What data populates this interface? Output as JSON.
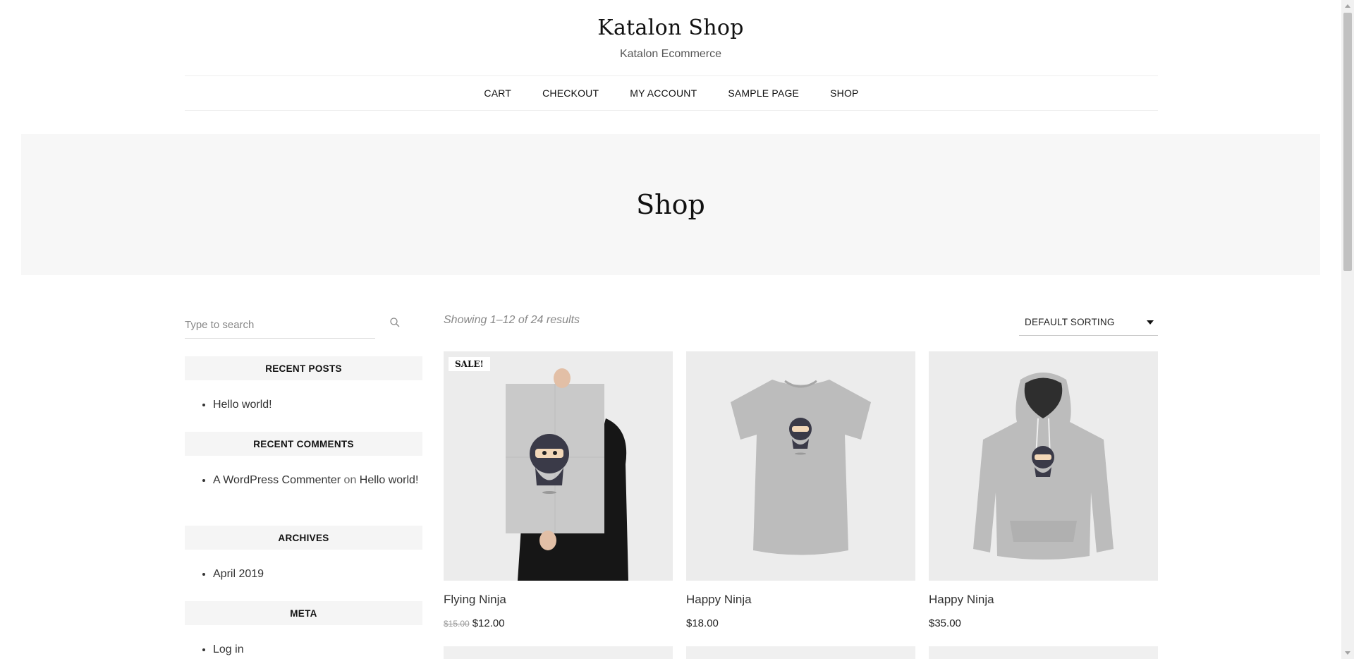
{
  "site": {
    "title": "Katalon Shop",
    "description": "Katalon Ecommerce"
  },
  "nav": {
    "cart": "Cart",
    "checkout": "Checkout",
    "my_account": "My Account",
    "sample_page": "Sample Page",
    "shop": "Shop"
  },
  "banner": {
    "title": "Shop"
  },
  "sidebar": {
    "search_placeholder": "Type to search",
    "recent_posts": {
      "title": "Recent Posts",
      "items": [
        "Hello world!"
      ]
    },
    "recent_comments": {
      "title": "Recent Comments",
      "author": "A WordPress Commenter",
      "connector": "on",
      "post": "Hello world!"
    },
    "archives": {
      "title": "Archives",
      "items": [
        "April 2019"
      ]
    },
    "meta": {
      "title": "Meta",
      "items": [
        "Log in"
      ]
    }
  },
  "toolbar": {
    "result_count": "Showing 1–12 of 24 results",
    "sorting": "Default sorting"
  },
  "products": [
    {
      "name": "Flying Ninja",
      "old_price": "$15.00",
      "price": "$12.00",
      "badge": "SALE!",
      "image": "poster-icon"
    },
    {
      "name": "Happy Ninja",
      "price": "$18.00",
      "image": "tshirt-icon"
    },
    {
      "name": "Happy Ninja",
      "price": "$35.00",
      "image": "hoodie-icon"
    }
  ],
  "colors": {
    "banner_bg": "#f7f7f7",
    "widget_bg": "#f5f5f5",
    "product_bg": "#ececec",
    "accent": "#111111"
  }
}
